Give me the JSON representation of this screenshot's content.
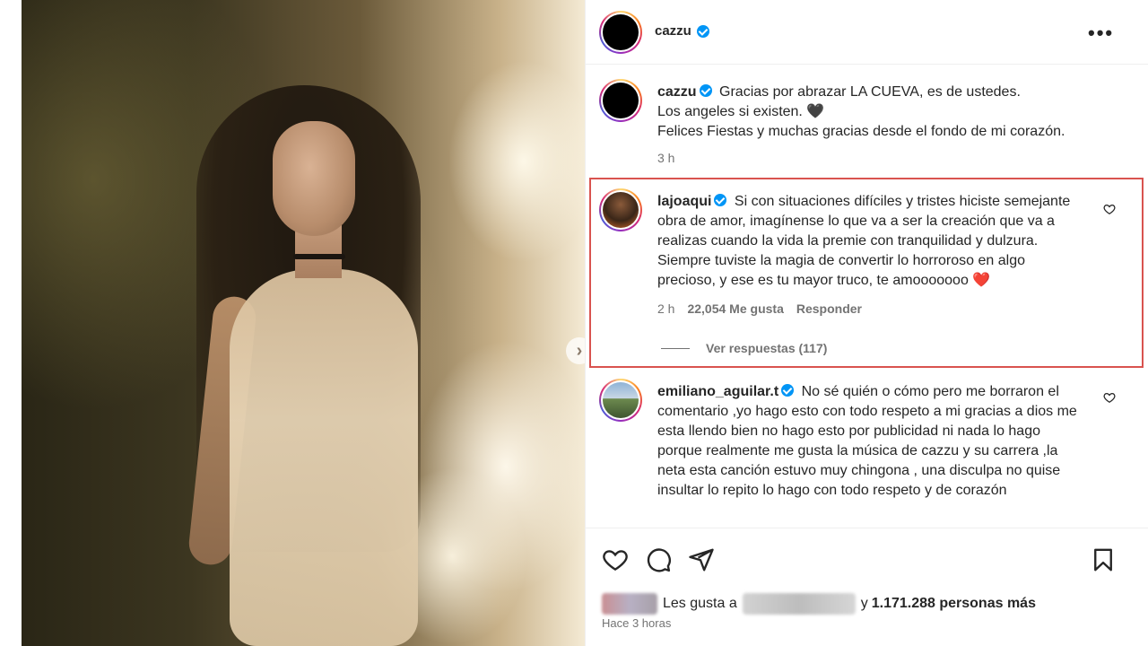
{
  "post": {
    "username": "cazzu",
    "caption_lines": [
      "Gracias por abrazar LA CUEVA, es de ustedes.",
      "Los angeles si existen. 🖤",
      "Felices Fiestas y muchas gracias desde el fondo de mi corazón."
    ],
    "caption_time": "3 h"
  },
  "comments": [
    {
      "username": "lajoaqui",
      "text": "Si con situaciones difíciles y tristes hiciste semejante obra de amor, imagínense lo que va a ser la creación que va a realizas cuando la vida la premie con tranquilidad y dulzura. Siempre tuviste la magia de convertir lo horroroso en algo precioso, y ese es tu mayor truco, te amooooooo ❤️",
      "time": "2 h",
      "likes": "22,054 Me gusta",
      "reply": "Responder",
      "view_replies": "Ver respuestas (117)"
    },
    {
      "username": "emiliano_aguilar.t",
      "text": "No sé quién o cómo pero me borraron el comentario ,yo hago esto con todo respeto a mi gracias a dios me esta llendo bien no hago esto por publicidad ni nada lo hago porque realmente me gusta la música de cazzu y su carrera ,la neta esta canción estuvo muy chingona , una disculpa no quise insultar lo repito lo hago con todo respeto y de corazón"
    }
  ],
  "footer": {
    "liked_by_prefix": "Les gusta a",
    "liked_by_connector": "y",
    "liked_by_count": "1.171.288 personas más",
    "posted": "Hace 3 horas"
  },
  "icons": {
    "like": "heart-icon",
    "comment": "comment-icon",
    "share": "share-icon",
    "save": "bookmark-icon",
    "more": "more-options-icon",
    "verified": "verified-badge-icon",
    "next": "chevron-right-icon"
  },
  "colors": {
    "verified": "#0095f6",
    "highlight": "#d9534f",
    "secondary_text": "#737373"
  }
}
